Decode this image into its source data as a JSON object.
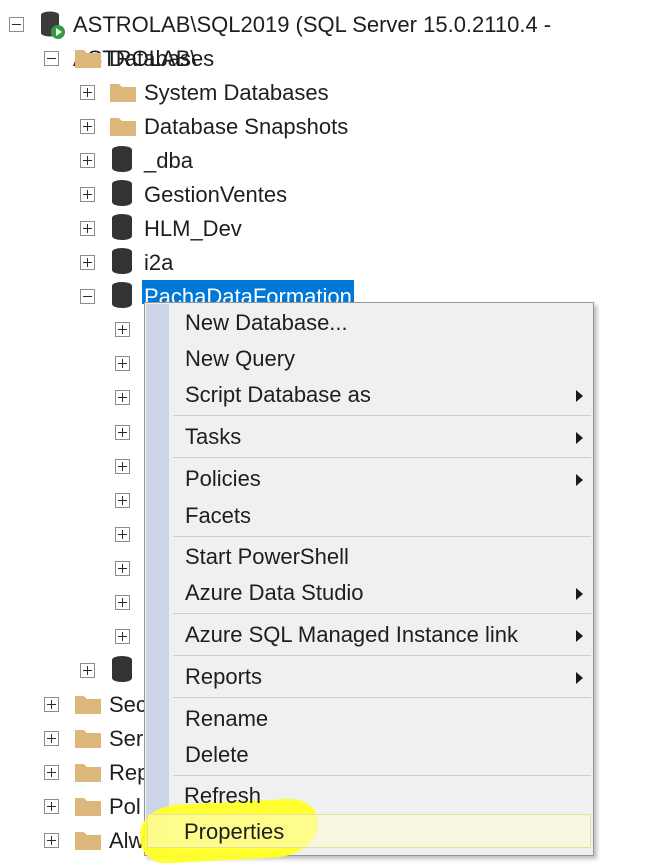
{
  "tree": {
    "server": {
      "label": "ASTROLAB\\SQL2019 (SQL Server 15.0.2110.4 - ASTROLAB\\"
    },
    "databases_label": "Databases",
    "db_children": [
      {
        "label": "System Databases",
        "icon": "folder-icon"
      },
      {
        "label": "Database Snapshots",
        "icon": "folder-icon"
      },
      {
        "label": "_dba",
        "icon": "database-icon"
      },
      {
        "label": "GestionVentes",
        "icon": "database-icon"
      },
      {
        "label": "HLM_Dev",
        "icon": "database-icon"
      },
      {
        "label": "i2a",
        "icon": "database-icon"
      }
    ],
    "selected_db": "PachaDataFormation",
    "bottom_folders": [
      "Sec",
      "Ser",
      "Rep",
      "Pol",
      "Alw"
    ]
  },
  "context_menu": {
    "items": [
      {
        "label": "New Database..."
      },
      {
        "label": "New Query"
      },
      {
        "label": "Script Database as",
        "submenu": true
      },
      {
        "label": "Tasks",
        "submenu": true
      },
      {
        "label": "Policies",
        "submenu": true
      },
      {
        "label": "Facets"
      },
      {
        "label": "Start PowerShell"
      },
      {
        "label": "Azure Data Studio",
        "submenu": true
      },
      {
        "label": "Azure SQL Managed Instance link",
        "submenu": true
      },
      {
        "label": "Reports",
        "submenu": true
      },
      {
        "label": "Rename"
      },
      {
        "label": "Delete"
      },
      {
        "label": "Refresh"
      },
      {
        "label": "Properties",
        "highlighted": true
      }
    ]
  },
  "colors": {
    "selection": "#0078d7",
    "folder": "#dcb67a",
    "highlighter": "#ffff26"
  }
}
